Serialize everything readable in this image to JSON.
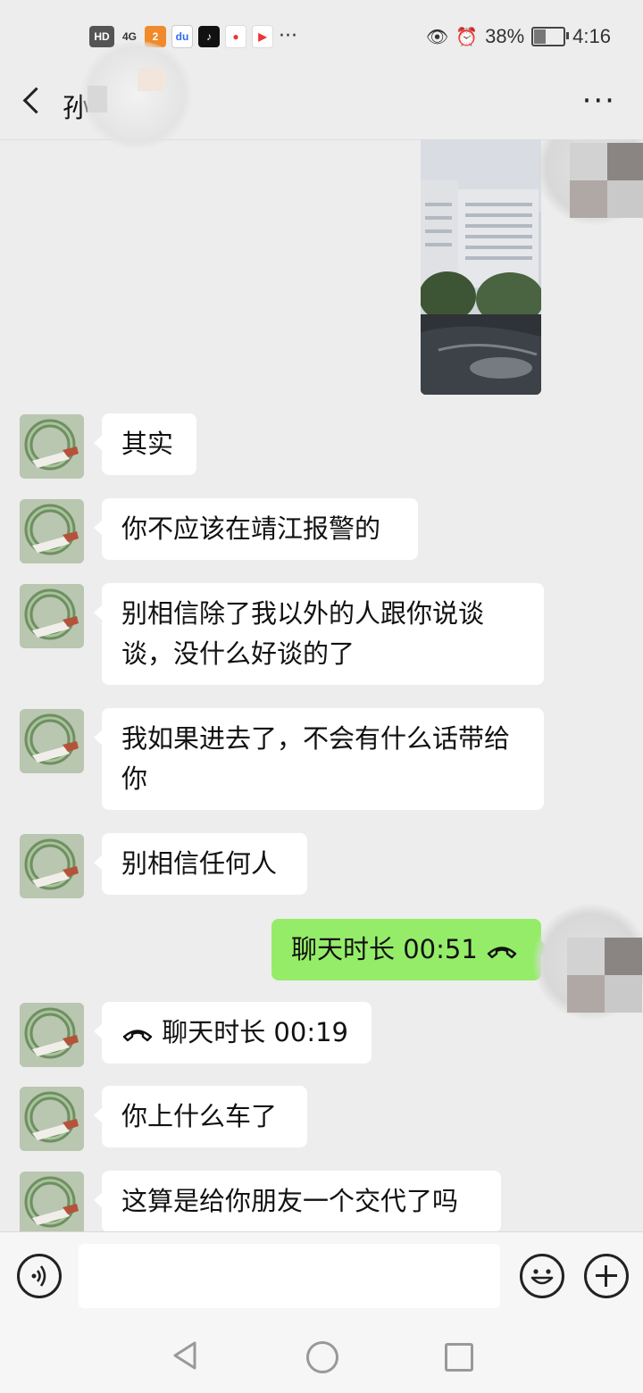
{
  "status_bar": {
    "left_badges": [
      "HD",
      "4G"
    ],
    "app_icons": [
      "app-icon-1",
      "baidu-icon",
      "tiktok-icon",
      "map-pin-icon",
      "video-play-icon"
    ],
    "more": "···",
    "battery": "38%",
    "battery_level": 0.38,
    "time": "4:16"
  },
  "header": {
    "title": "孙",
    "more": "···"
  },
  "messages": [
    {
      "from": "self",
      "type": "image"
    },
    {
      "from": "peer",
      "type": "text",
      "text": "其实"
    },
    {
      "from": "peer",
      "type": "text",
      "text": "你不应该在靖江报警的"
    },
    {
      "from": "peer",
      "type": "text",
      "text": "别相信除了我以外的人跟你说谈谈，没什么好谈的了"
    },
    {
      "from": "peer",
      "type": "text",
      "text": "我如果进去了，不会有什么话带给你"
    },
    {
      "from": "peer",
      "type": "text",
      "text": "别相信任何人"
    },
    {
      "from": "self",
      "type": "call",
      "text": "聊天时长 00:51"
    },
    {
      "from": "peer",
      "type": "call",
      "text": "聊天时长 00:19"
    },
    {
      "from": "peer",
      "type": "text",
      "text": "你上什么车了"
    },
    {
      "from": "peer",
      "type": "text",
      "text": "这算是给你朋友一个交代了吗"
    }
  ],
  "colors": {
    "background": "#ededed",
    "self_bubble": "#95ec69",
    "peer_bubble": "#ffffff"
  },
  "input": {
    "placeholder": ""
  }
}
